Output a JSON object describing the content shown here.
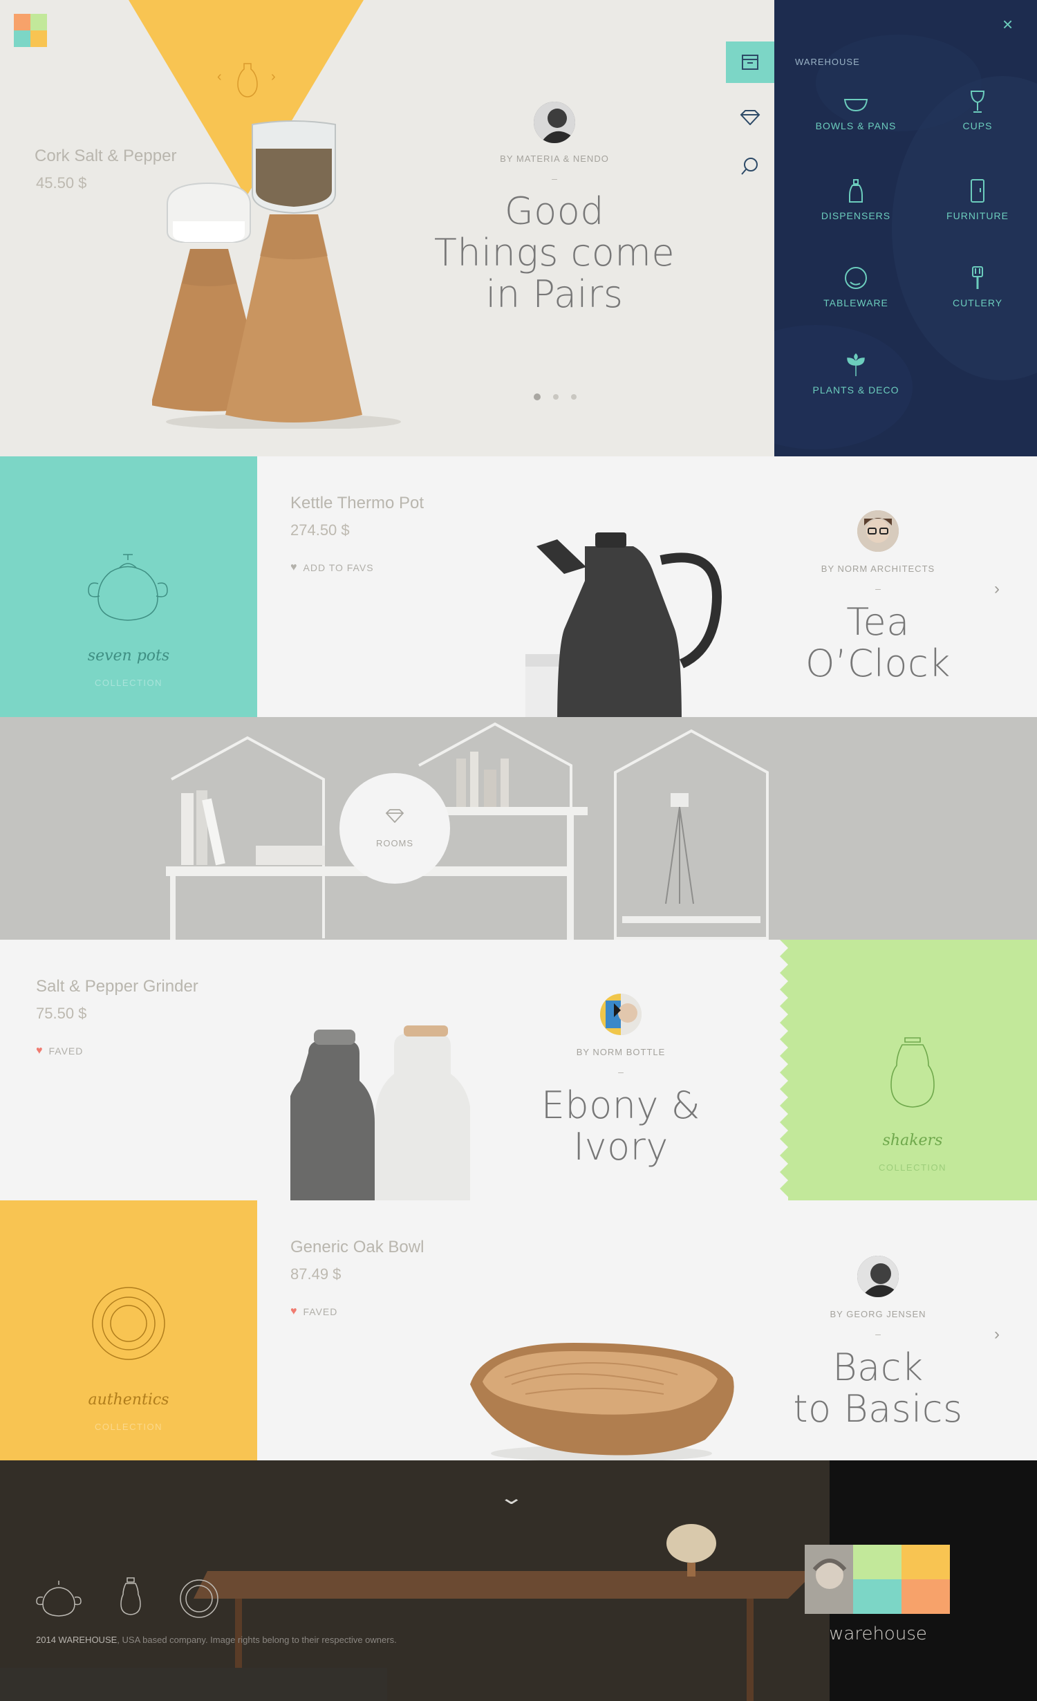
{
  "colors": {
    "yellow": "#f8c452",
    "teal": "#7cd6c6",
    "green": "#c2e89a",
    "orange": "#f7a26a",
    "navy": "#1d2c4f",
    "accent_teal": "#6ccdbd",
    "heart": "#f07b70"
  },
  "hero": {
    "product_title": "Cork Salt & Pepper",
    "product_price": "45.50 $",
    "byline": "BY MATERIA & NENDO",
    "dash": "–",
    "headline_lines": [
      "Good",
      "Things come",
      "in Pairs"
    ],
    "slides": 3,
    "active_slide": 1
  },
  "side_strip": {
    "icons": [
      "archive-icon",
      "diamond-icon",
      "search-icon"
    ]
  },
  "warehouse": {
    "title": "WAREHOUSE",
    "items": [
      {
        "label": "BOWLS & PANS",
        "icon": "bowl-icon"
      },
      {
        "label": "CUPS",
        "icon": "cup-icon"
      },
      {
        "label": "DISPENSERS",
        "icon": "dispenser-icon"
      },
      {
        "label": "FURNITURE",
        "icon": "furniture-icon"
      },
      {
        "label": "TABLEWARE",
        "icon": "plate-icon"
      },
      {
        "label": "CUTLERY",
        "icon": "cutlery-icon"
      },
      {
        "label": "PLANTS & DECO",
        "icon": "plant-icon"
      }
    ]
  },
  "row1": {
    "collection_name": "seven pots",
    "collection_label": "COLLECTION",
    "product_title": "Kettle Thermo Pot",
    "product_price": "274.50 $",
    "fav_label": "ADD TO FAVS",
    "byline": "BY NORM ARCHITECTS",
    "dash": "–",
    "headline_lines": [
      "Tea",
      "O’Clock"
    ]
  },
  "rooms": {
    "label": "ROOMS"
  },
  "row2": {
    "product_title": "Salt & Pepper Grinder",
    "product_price": "75.50 $",
    "fav_label": "FAVED",
    "byline": "BY NORM BOTTLE",
    "dash": "–",
    "headline_lines": [
      "Ebony &",
      "Ivory"
    ],
    "collection_name": "shakers",
    "collection_label": "COLLECTION"
  },
  "row3": {
    "collection_name": "authentics",
    "collection_label": "COLLECTION",
    "product_title": "Generic Oak Bowl",
    "product_price": "87.49 $",
    "fav_label": "FAVED",
    "byline": "BY GEORG JENSEN",
    "dash": "–",
    "headline_lines": [
      "Back",
      "to Basics"
    ]
  },
  "footer": {
    "copyright_strong": "2014 WAREHOUSE",
    "copyright_rest": ", USA based company. Image rights belong to their respective owners.",
    "brand": "warehouse"
  }
}
